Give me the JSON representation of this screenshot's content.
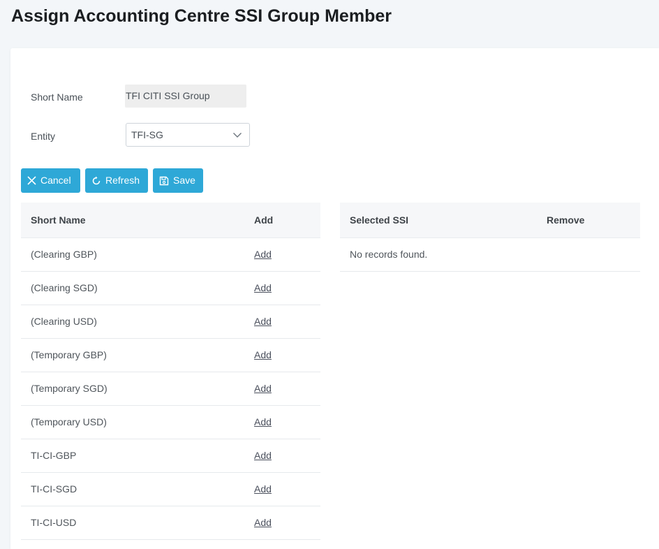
{
  "page": {
    "title": "Assign Accounting Centre SSI Group Member"
  },
  "form": {
    "short_name_label": "Short Name",
    "short_name_value": "TFI CITI SSI Group",
    "entity_label": "Entity",
    "entity_value": "TFI-SG"
  },
  "toolbar": {
    "cancel_label": "Cancel",
    "refresh_label": "Refresh",
    "save_label": "Save",
    "button_color": "#2ea8d7"
  },
  "available_table": {
    "headers": [
      "Short Name",
      "Add"
    ],
    "rows": [
      {
        "name": "(Clearing GBP)",
        "action": "Add"
      },
      {
        "name": "(Clearing SGD)",
        "action": "Add"
      },
      {
        "name": "(Clearing USD)",
        "action": "Add"
      },
      {
        "name": "(Temporary GBP)",
        "action": "Add"
      },
      {
        "name": "(Temporary SGD)",
        "action": "Add"
      },
      {
        "name": "(Temporary USD)",
        "action": "Add"
      },
      {
        "name": "TI-CI-GBP",
        "action": "Add"
      },
      {
        "name": "TI-CI-SGD",
        "action": "Add"
      },
      {
        "name": "TI-CI-USD",
        "action": "Add"
      }
    ]
  },
  "selected_table": {
    "headers": [
      "Selected SSI",
      "Remove"
    ],
    "empty_message": "No records found."
  }
}
